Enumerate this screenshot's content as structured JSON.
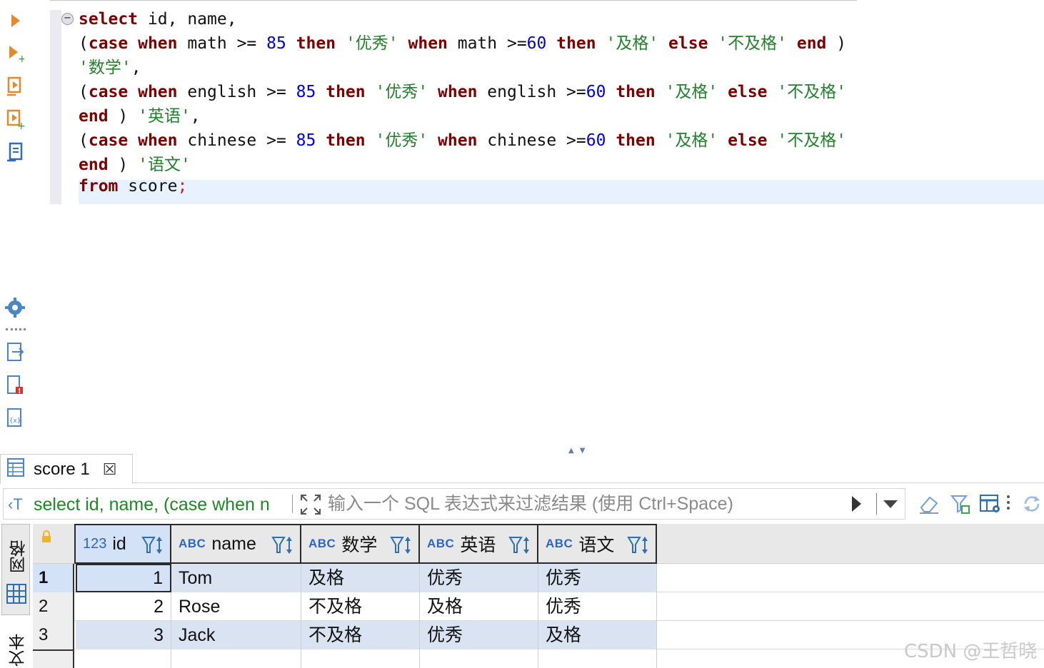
{
  "editor": {
    "lines": [
      [
        {
          "t": "select",
          "c": "kw"
        },
        {
          "t": " id, name,",
          "c": ""
        }
      ],
      [
        {
          "t": "(",
          "c": ""
        },
        {
          "t": "case",
          "c": "kw"
        },
        {
          "t": " ",
          "c": ""
        },
        {
          "t": "when",
          "c": "kw"
        },
        {
          "t": " math >= ",
          "c": ""
        },
        {
          "t": "85",
          "c": "num"
        },
        {
          "t": " ",
          "c": ""
        },
        {
          "t": "then",
          "c": "kw"
        },
        {
          "t": " ",
          "c": ""
        },
        {
          "t": "'优秀'",
          "c": "str"
        },
        {
          "t": " ",
          "c": ""
        },
        {
          "t": "when",
          "c": "kw"
        },
        {
          "t": " math >=",
          "c": ""
        },
        {
          "t": "60",
          "c": "num"
        },
        {
          "t": " ",
          "c": ""
        },
        {
          "t": "then",
          "c": "kw"
        },
        {
          "t": " ",
          "c": ""
        },
        {
          "t": "'及格'",
          "c": "str"
        },
        {
          "t": " ",
          "c": ""
        },
        {
          "t": "else",
          "c": "kw"
        },
        {
          "t": " ",
          "c": ""
        },
        {
          "t": "'不及格'",
          "c": "str"
        },
        {
          "t": " ",
          "c": ""
        },
        {
          "t": "end",
          "c": "kw"
        },
        {
          "t": " )",
          "c": ""
        }
      ],
      [
        {
          "t": "'数学'",
          "c": "str"
        },
        {
          "t": ",",
          "c": ""
        }
      ],
      [
        {
          "t": "(",
          "c": ""
        },
        {
          "t": "case",
          "c": "kw"
        },
        {
          "t": " ",
          "c": ""
        },
        {
          "t": "when",
          "c": "kw"
        },
        {
          "t": " english >= ",
          "c": ""
        },
        {
          "t": "85",
          "c": "num"
        },
        {
          "t": " ",
          "c": ""
        },
        {
          "t": "then",
          "c": "kw"
        },
        {
          "t": " ",
          "c": ""
        },
        {
          "t": "'优秀'",
          "c": "str"
        },
        {
          "t": " ",
          "c": ""
        },
        {
          "t": "when",
          "c": "kw"
        },
        {
          "t": " english >=",
          "c": ""
        },
        {
          "t": "60",
          "c": "num"
        },
        {
          "t": " ",
          "c": ""
        },
        {
          "t": "then",
          "c": "kw"
        },
        {
          "t": " ",
          "c": ""
        },
        {
          "t": "'及格'",
          "c": "str"
        },
        {
          "t": " ",
          "c": ""
        },
        {
          "t": "else",
          "c": "kw"
        },
        {
          "t": " ",
          "c": ""
        },
        {
          "t": "'不及格'",
          "c": "str"
        }
      ],
      [
        {
          "t": "end",
          "c": "kw"
        },
        {
          "t": " ) ",
          "c": ""
        },
        {
          "t": "'英语'",
          "c": "str"
        },
        {
          "t": ",",
          "c": ""
        }
      ],
      [
        {
          "t": "(",
          "c": ""
        },
        {
          "t": "case",
          "c": "kw"
        },
        {
          "t": " ",
          "c": ""
        },
        {
          "t": "when",
          "c": "kw"
        },
        {
          "t": " chinese >= ",
          "c": ""
        },
        {
          "t": "85",
          "c": "num"
        },
        {
          "t": " ",
          "c": ""
        },
        {
          "t": "then",
          "c": "kw"
        },
        {
          "t": " ",
          "c": ""
        },
        {
          "t": "'优秀'",
          "c": "str"
        },
        {
          "t": " ",
          "c": ""
        },
        {
          "t": "when",
          "c": "kw"
        },
        {
          "t": " chinese >=",
          "c": ""
        },
        {
          "t": "60",
          "c": "num"
        },
        {
          "t": " ",
          "c": ""
        },
        {
          "t": "then",
          "c": "kw"
        },
        {
          "t": " ",
          "c": ""
        },
        {
          "t": "'及格'",
          "c": "str"
        },
        {
          "t": " ",
          "c": ""
        },
        {
          "t": "else",
          "c": "kw"
        },
        {
          "t": " ",
          "c": ""
        },
        {
          "t": "'不及格'",
          "c": "str"
        }
      ],
      [
        {
          "t": "end",
          "c": "kw"
        },
        {
          "t": " ) ",
          "c": ""
        },
        {
          "t": "'语文'",
          "c": "str"
        }
      ],
      [
        {
          "t": "from",
          "c": "kw"
        },
        {
          "t": " score",
          "c": ""
        },
        {
          "t": ";",
          "c": "semi"
        }
      ]
    ]
  },
  "result_tab": {
    "title": "score 1",
    "close": "☒"
  },
  "filter_bar": {
    "prefix": "‹T",
    "sql_preview": "select id, name, (case when n",
    "placeholder": "输入一个 SQL 表达式来过滤结果 (使用 Ctrl+Space)"
  },
  "side_tabs": {
    "grid": "网格",
    "text": "文本"
  },
  "grid": {
    "columns": [
      {
        "type": "123",
        "label": "id"
      },
      {
        "type": "ABC",
        "label": "name"
      },
      {
        "type": "ABC",
        "label": "数学"
      },
      {
        "type": "ABC",
        "label": "英语"
      },
      {
        "type": "ABC",
        "label": "语文"
      }
    ],
    "rows": [
      {
        "num": "1",
        "id": "1",
        "name": "Tom",
        "math": "及格",
        "english": "优秀",
        "chinese": "优秀"
      },
      {
        "num": "2",
        "id": "2",
        "name": "Rose",
        "math": "不及格",
        "english": "及格",
        "chinese": "优秀"
      },
      {
        "num": "3",
        "id": "3",
        "name": "Jack",
        "math": "不及格",
        "english": "优秀",
        "chinese": "及格"
      }
    ]
  },
  "watermark": "CSDN @王哲晓",
  "colors": {
    "keyword": "#7f0000",
    "number": "#0000e6",
    "string": "#23802b",
    "selection": "#d3e2f7",
    "row_alt": "#d9e3f1"
  }
}
